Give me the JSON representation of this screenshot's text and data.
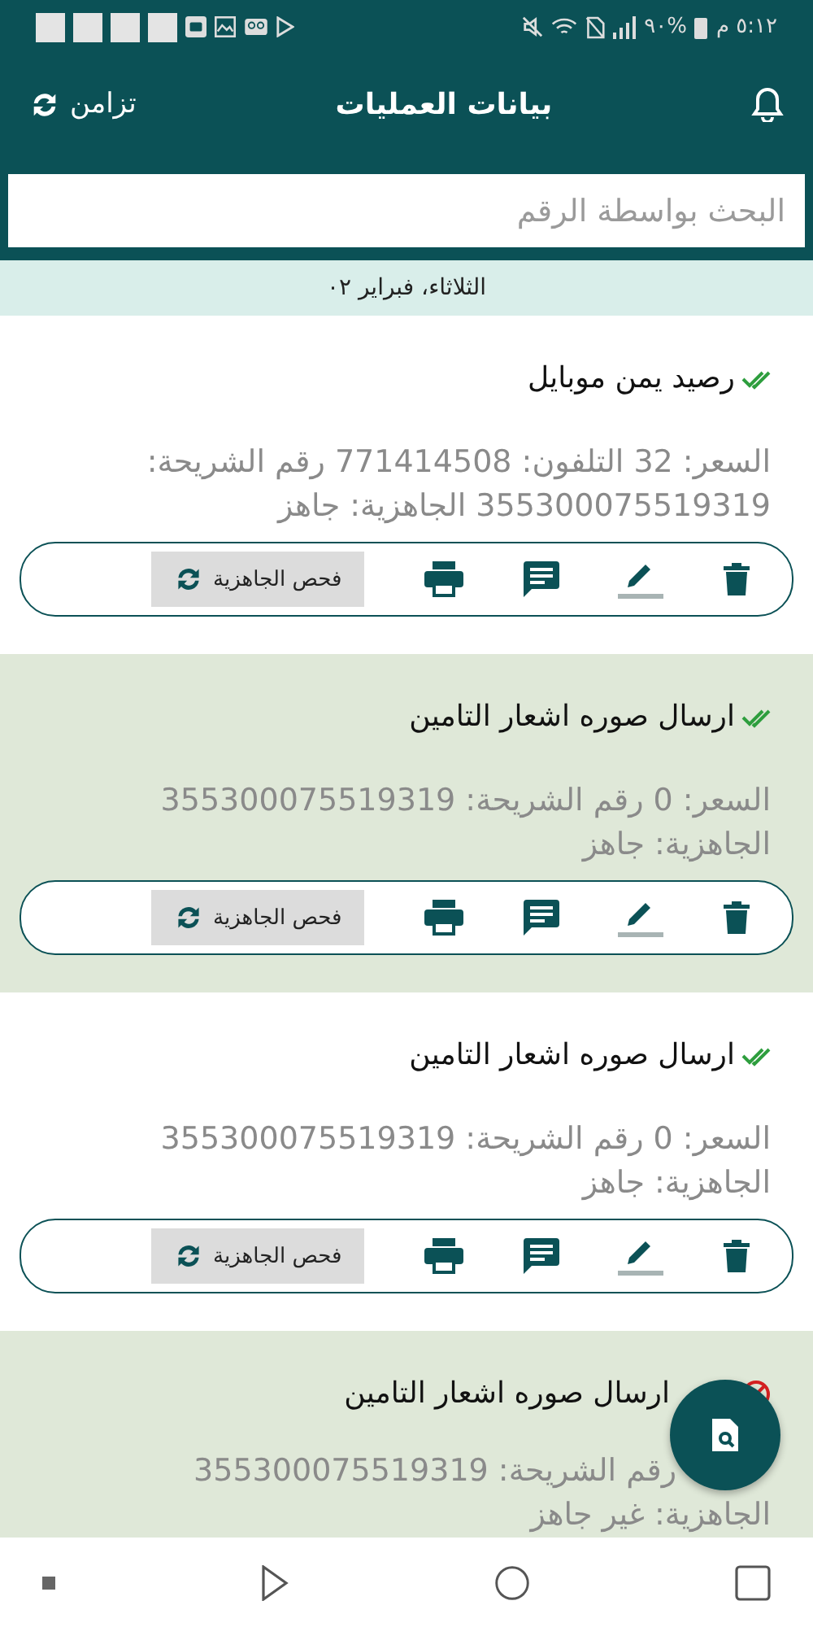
{
  "status_bar": {
    "time": "٥:١٢ م",
    "battery": "%٩٠"
  },
  "app_bar": {
    "title": "بيانات العمليات",
    "sync_label": "تزامن"
  },
  "search": {
    "placeholder": "البحث بواسطة الرقم"
  },
  "date_header": "الثلاثاء، فبراير ٠٢",
  "records": [
    {
      "title": "رصيد يمن موبايل",
      "done": true,
      "shaded": false,
      "details": [
        "السعر: 32   التلفون: 771414508  رقم الشريحة:",
        "355300075519319  الجاهزية: جاهز"
      ],
      "check_button": "فحص الجاهزية"
    },
    {
      "title": "ارسال صوره اشعار التامين",
      "done": true,
      "shaded": true,
      "details": [
        "السعر: 0  رقم الشريحة: 355300075519319",
        "الجاهزية: جاهز"
      ],
      "check_button": "فحص الجاهزية"
    },
    {
      "title": "ارسال صوره اشعار التامين",
      "done": true,
      "shaded": false,
      "details": [
        "السعر: 0  رقم الشريحة: 355300075519319",
        "الجاهزية: جاهز"
      ],
      "check_button": "فحص الجاهزية"
    },
    {
      "title": "ارسال صوره اشعار التامين",
      "done": false,
      "shaded": true,
      "details": [
        "رقم الشريحة: 355300075519319",
        "الجاهزية: غير جاهز"
      ]
    }
  ]
}
